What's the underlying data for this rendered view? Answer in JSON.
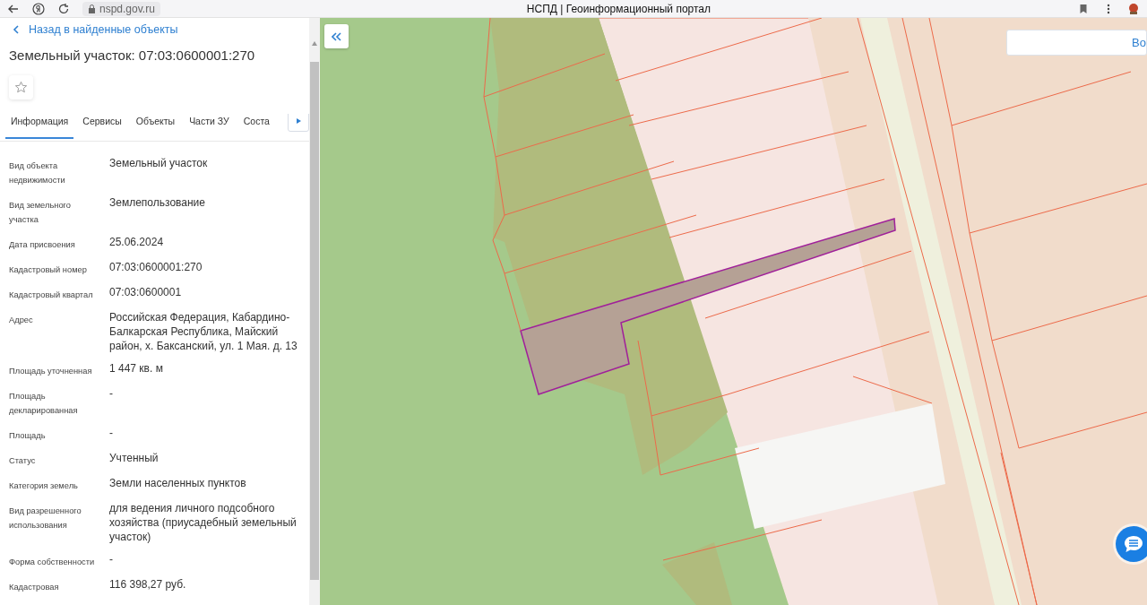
{
  "browser": {
    "url": "nspd.gov.ru",
    "title": "НСПД | Геоинформационный портал"
  },
  "panel": {
    "back_link": "Назад в найденные объекты",
    "title": "Земельный участок: 07:03:0600001:270",
    "favorited": false,
    "tabs": [
      {
        "label": "Информация",
        "selected": true
      },
      {
        "label": "Сервисы",
        "selected": false
      },
      {
        "label": "Объекты",
        "selected": false
      },
      {
        "label": "Части ЗУ",
        "selected": false
      },
      {
        "label": "Соста",
        "selected": false
      }
    ],
    "fields": [
      {
        "label": "Вид объекта недвижимости",
        "value": "Земельный участок"
      },
      {
        "label": "Вид земельного участка",
        "value": "Землепользование"
      },
      {
        "label": "Дата присвоения",
        "value": "25.06.2024"
      },
      {
        "label": "Кадастровый номер",
        "value": "07:03:0600001:270"
      },
      {
        "label": "Кадастровый квартал",
        "value": "07:03:0600001"
      },
      {
        "label": "Адрес",
        "value": "Российская Федерация, Кабардино-Балкарская Республика, Майский район, х. Баксанский, ул. 1 Мая. д. 13"
      },
      {
        "label": "Площадь уточненная",
        "value": "1 447 кв. м"
      },
      {
        "label": "Площадь декларированная",
        "value": "-"
      },
      {
        "label": "Площадь",
        "value": "-"
      },
      {
        "label": "Статус",
        "value": "Учтенный"
      },
      {
        "label": "Категория земель",
        "value": "Земли населенных пунктов"
      },
      {
        "label": "Вид разрешенного использования",
        "value": "для ведения личного подсобного хозяйства (приусадебный земельный участок)"
      },
      {
        "label": "Форма собственности",
        "value": "-"
      },
      {
        "label": "Кадастровая",
        "value": "116 398,27 руб."
      }
    ]
  },
  "map": {
    "corner_button": "Во"
  }
}
